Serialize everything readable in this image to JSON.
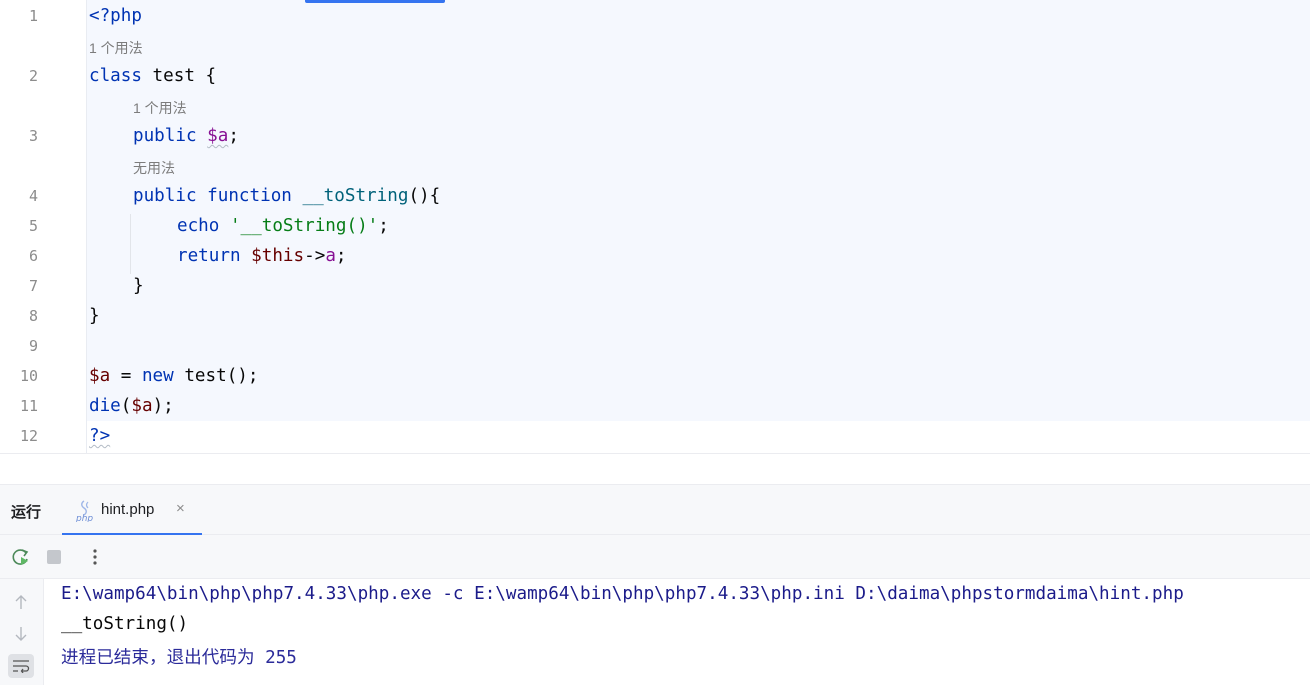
{
  "editor": {
    "line_numbers": [
      "1",
      "2",
      "3",
      "4",
      "5",
      "6",
      "7",
      "8",
      "9",
      "10",
      "11",
      "12"
    ],
    "hints": {
      "line2": "1 个用法",
      "line3": "1 个用法",
      "line4": "无用法"
    },
    "code": {
      "l1": "<?php",
      "l2_kw": "class",
      "l2_rest": " test {",
      "l3_kw": "public",
      "l3_var": "$a",
      "l3_end": ";",
      "l4_kw1": "public",
      "l4_kw2": "function",
      "l4_fn": "__toString",
      "l4_end": "(){",
      "l5_kw": "echo",
      "l5_str": "'__toString()'",
      "l5_end": ";",
      "l6_kw": "return",
      "l6_this": "$this",
      "l6_arrow": "->",
      "l6_prop": "a",
      "l6_end": ";",
      "l7": "}",
      "l8": "}",
      "l10_var": "$a",
      "l10_eq": " = ",
      "l10_kw": "new",
      "l10_rest": " test();",
      "l11_fn": "die",
      "l11_open": "(",
      "l11_var": "$a",
      "l11_close": ");",
      "l12": "?>"
    }
  },
  "run_window": {
    "title": "运行",
    "tab_label": "hint.php",
    "tab_icon": "php-file-icon",
    "tab_close": "×",
    "toolbar": [
      "rerun-icon",
      "stop-icon",
      "more-options-icon"
    ],
    "side": [
      "scroll-up-icon",
      "scroll-down-icon",
      "soft-wrap-icon"
    ],
    "console_lines": {
      "command": "E:\\wamp64\\bin\\php\\php7.4.33\\php.exe -c E:\\wamp64\\bin\\php\\php7.4.33\\php.ini D:\\daima\\phpstormdaima\\hint.php",
      "output": "__toString()",
      "exit": "进程已结束，退出代码为 255"
    }
  },
  "colors": {
    "accent": "#3574f0",
    "keyword": "#0033b3",
    "string": "#067d17",
    "variable": "#871094"
  }
}
